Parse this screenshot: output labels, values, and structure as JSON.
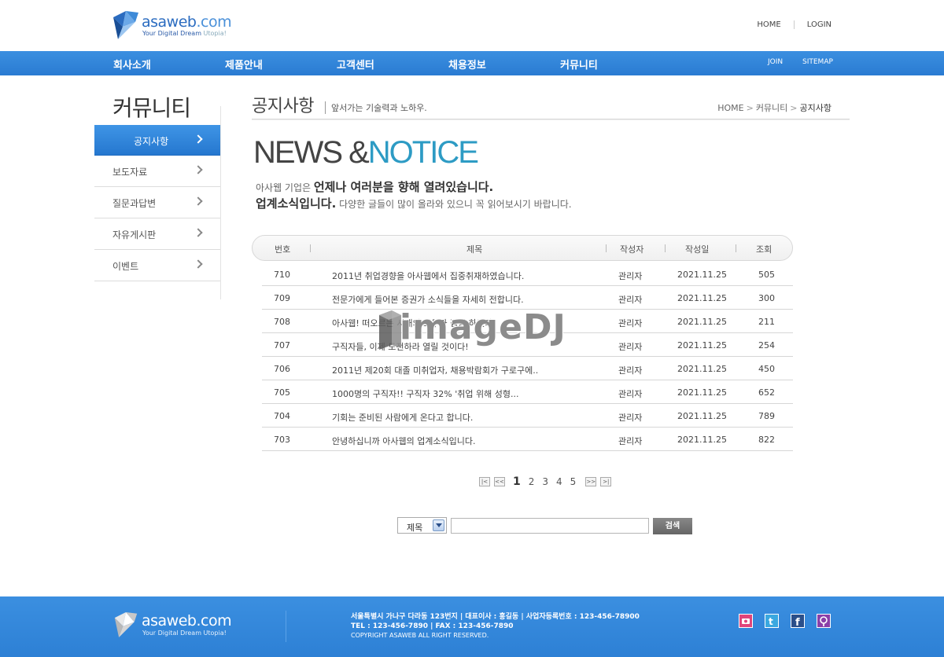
{
  "header": {
    "brand": "asaweb",
    "brand_suffix": ".com",
    "tagline": "Your Digital Dream",
    "tagline_suffix": "Utopia!",
    "links": [
      "HOME",
      "LOGIN"
    ]
  },
  "nav": {
    "items": [
      "회사소개",
      "제품안내",
      "고객센터",
      "채용정보",
      "커뮤니티"
    ],
    "sub_links": [
      "JOIN",
      "SITEMAP"
    ]
  },
  "sidebar": {
    "title": "커뮤니티",
    "items": [
      {
        "label": "공지사항",
        "active": true
      },
      {
        "label": "보도자료",
        "active": false
      },
      {
        "label": "질문과답변",
        "active": false
      },
      {
        "label": "자유게시판",
        "active": false
      },
      {
        "label": "이벤트",
        "active": false
      }
    ]
  },
  "page": {
    "title": "공지사항",
    "subtitle": "앞서가는 기술력과 노하우.",
    "breadcrumb": [
      "HOME",
      "커뮤니티",
      "공지사항"
    ],
    "heading_dark": "NEWS &",
    "heading_accent": "NOTICE",
    "intro_line1_a": "아사웹 기업은 ",
    "intro_line1_b": "언제나 여러분을 향해 열려있습니다.",
    "intro_line2_a": "업계소식입니다.",
    "intro_line2_b": " 다양한 글들이 많이 올라와 있으니 꼭 읽어보시기 바랍니다."
  },
  "table": {
    "headers": [
      "번호",
      "제목",
      "작성자",
      "작성일",
      "조회"
    ],
    "rows": [
      {
        "no": "710",
        "title": "2011년 취업경향을 아사웹에서 집중취재하였습니다.",
        "author": "관리자",
        "date": "2021.11.25",
        "views": "505"
      },
      {
        "no": "709",
        "title": "전문가에게 들어본 증권가 소식들을 자세히 전합니다.",
        "author": "관리자",
        "date": "2021.11.25",
        "views": "300"
      },
      {
        "no": "708",
        "title": "아사웹! 떠오르는 시대의 모두가 집중 하였다",
        "author": "관리자",
        "date": "2021.11.25",
        "views": "211"
      },
      {
        "no": "707",
        "title": "구직자들, 이제 도전하라 열릴 것이다!",
        "author": "관리자",
        "date": "2021.11.25",
        "views": "254"
      },
      {
        "no": "706",
        "title": "2011년 제20회 대졸 미취업자, 채용박람회가 구로구에..",
        "author": "관리자",
        "date": "2021.11.25",
        "views": "450"
      },
      {
        "no": "705",
        "title": "1000명의 구직자!! 구직자 32% '취업 위해 성형...",
        "author": "관리자",
        "date": "2021.11.25",
        "views": "652"
      },
      {
        "no": "704",
        "title": "기회는 준비된 사람에게 온다고 합니다.",
        "author": "관리자",
        "date": "2021.11.25",
        "views": "789"
      },
      {
        "no": "703",
        "title": "안녕하십니까 아사웹의 업계소식입니다.",
        "author": "관리자",
        "date": "2021.11.25",
        "views": "822"
      }
    ]
  },
  "watermark": "imageDJ",
  "pagination": {
    "first": "|<<",
    "prev": "<<",
    "pages": [
      "1",
      "2",
      "3",
      "4",
      "5"
    ],
    "current": "1",
    "next": ">>",
    "last": ">>|"
  },
  "search": {
    "select_value": "제목",
    "input_value": "",
    "button_label": "검색"
  },
  "footer": {
    "brand": "asaweb",
    "brand_suffix": ".com",
    "tagline": "Your Digital Dream Utopia!",
    "line1": "서울특별시 가나구 다라동 123번지  |  대표이사 : 홍길동  |  사업자등록번호 : 123-456-78900",
    "line2": "TEL : 123-456-7890  |  FAX : 123-456-7890",
    "line3": "COPYRIGHT ASAWEB ALL RIGHT RESERVED.",
    "social_icons": [
      "camera-icon",
      "twitter-icon",
      "facebook-icon",
      "pin-icon"
    ]
  },
  "colors": {
    "brand_blue": "#2a7bd2",
    "accent_teal": "#2d9bc4",
    "search_button": "#777777"
  }
}
